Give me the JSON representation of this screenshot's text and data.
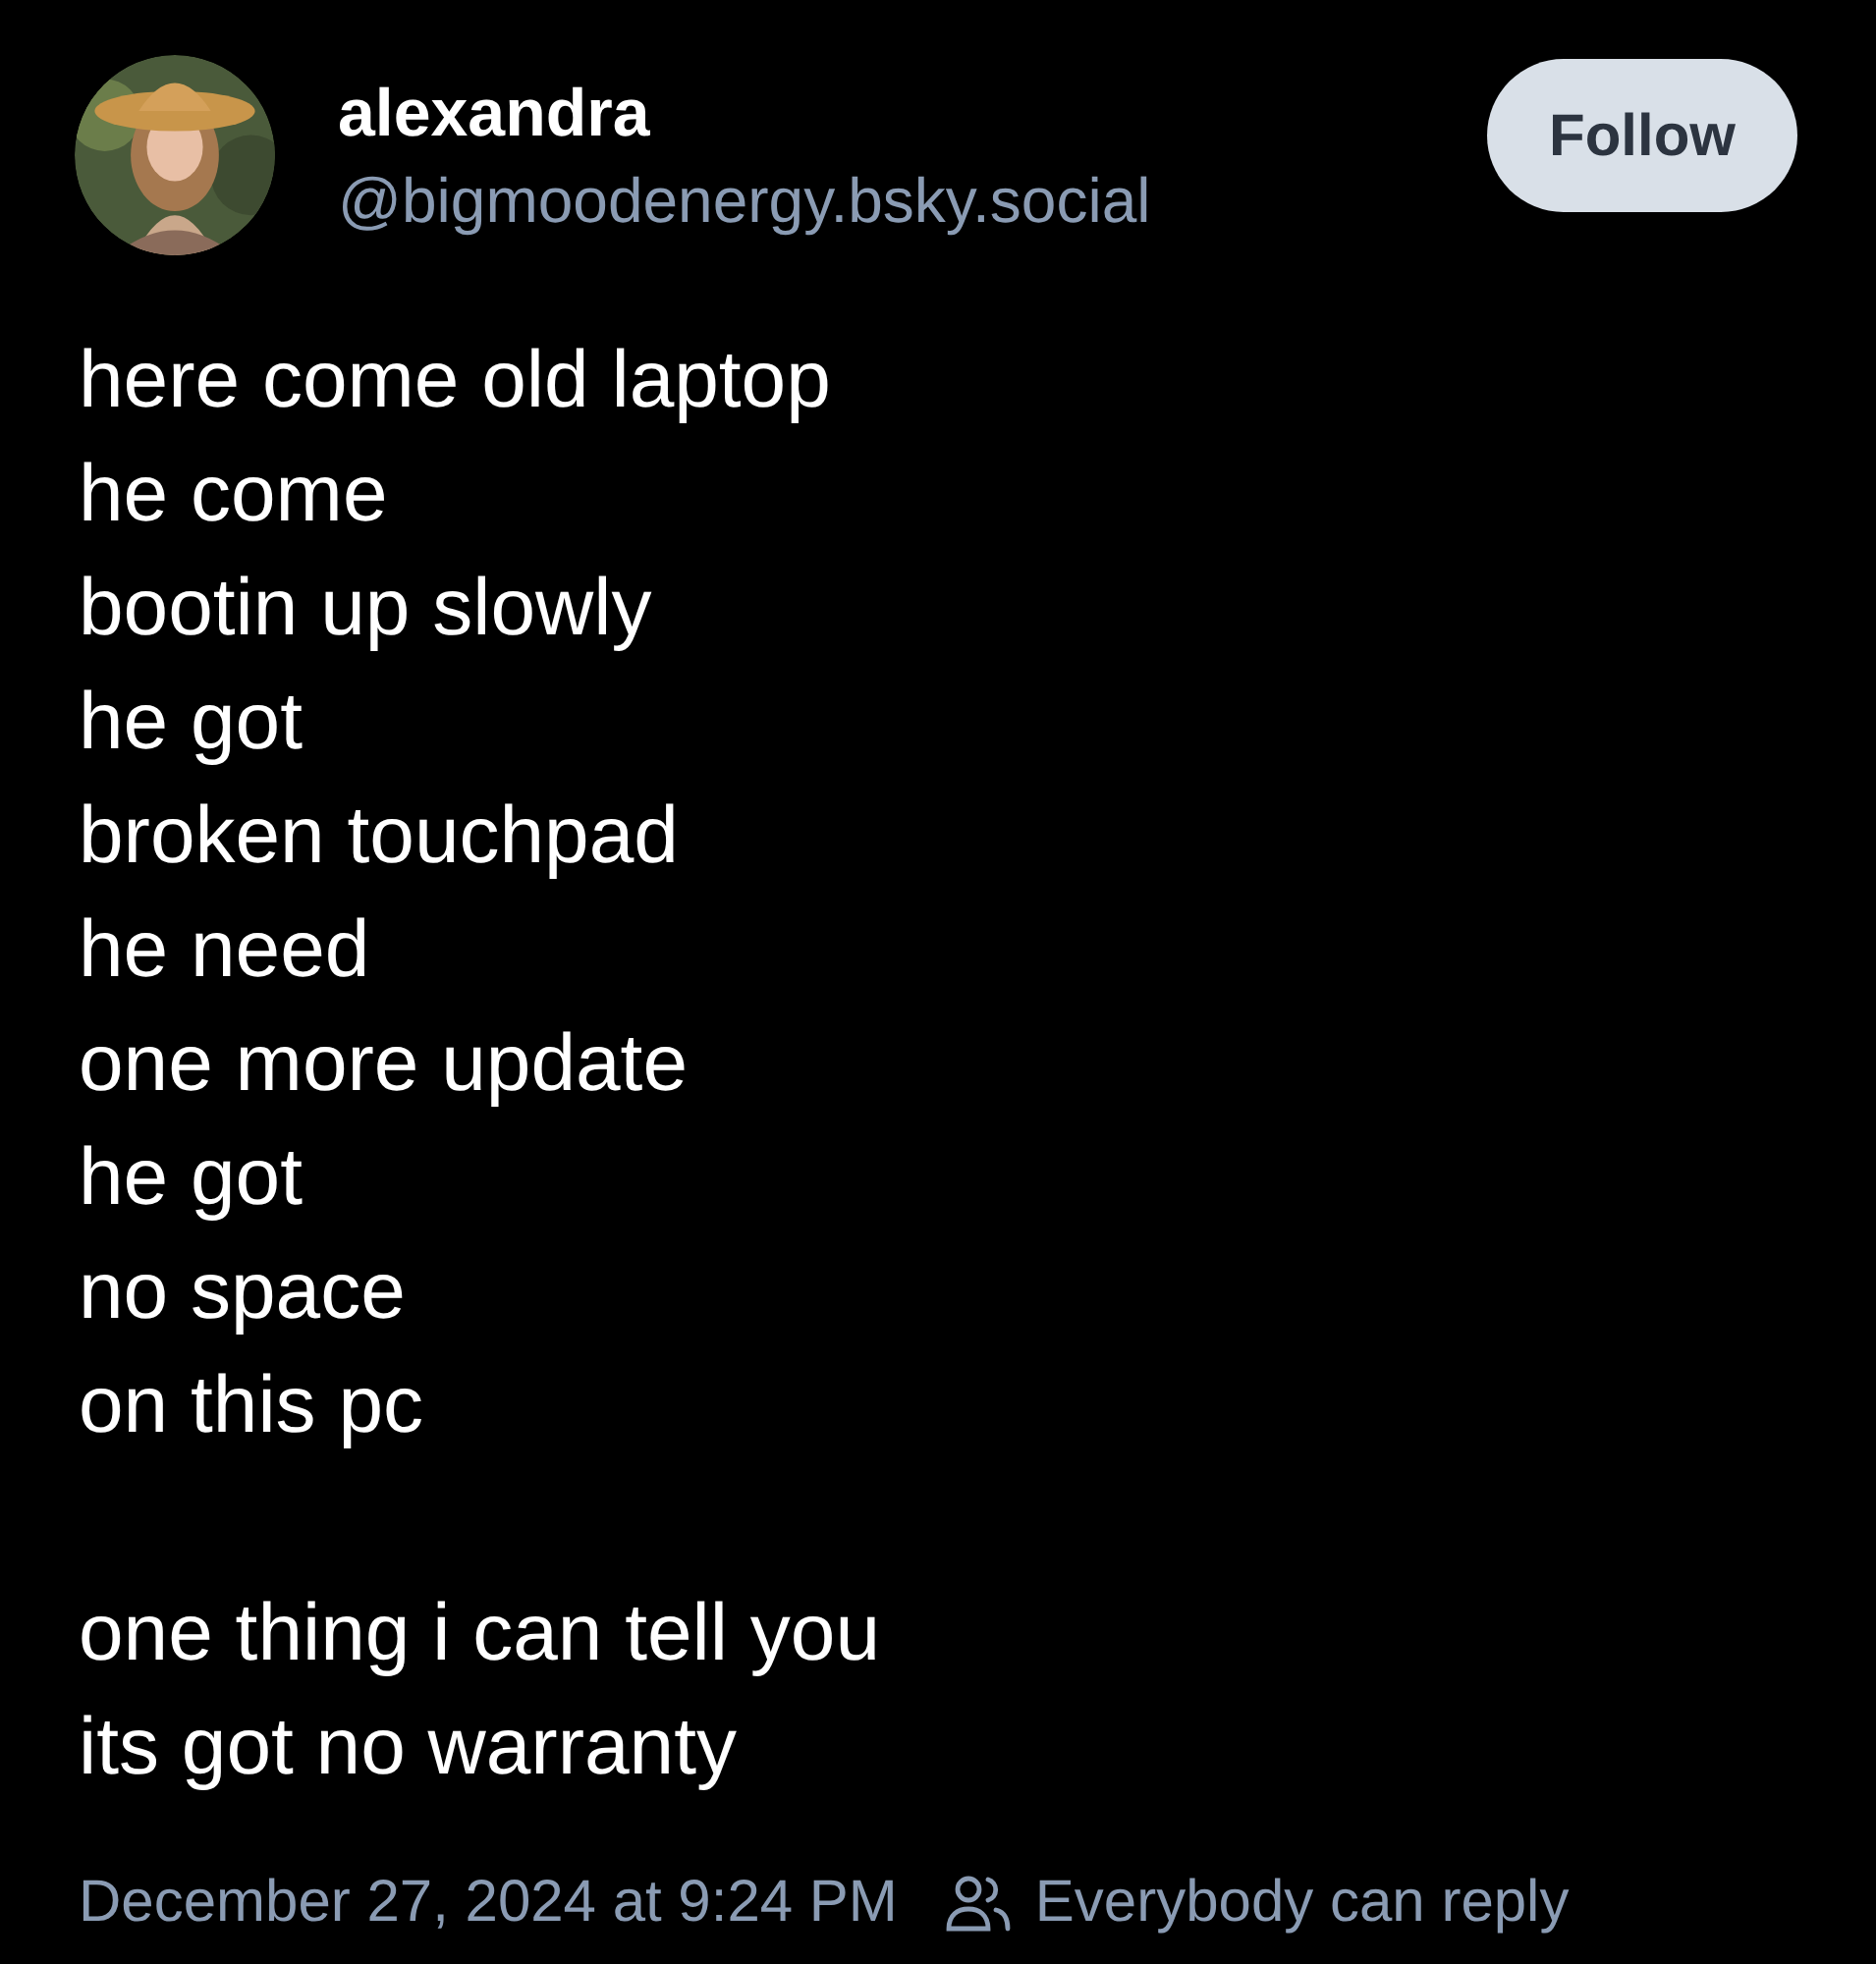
{
  "author": {
    "name": "alexandra",
    "handle": "@bigmoodenergy.bsky.social"
  },
  "follow_button": {
    "label": "Follow"
  },
  "post": {
    "stanzas": [
      [
        "here come old laptop",
        "he come",
        "bootin up slowly",
        "he got",
        "broken touchpad",
        "he need",
        "one more update",
        "he got",
        "no space",
        "on this pc"
      ],
      [
        "one thing i can tell you",
        "its got no warranty"
      ]
    ]
  },
  "footer": {
    "timestamp": "December 27, 2024 at 9:24 PM",
    "reply_setting": "Everybody can reply"
  }
}
